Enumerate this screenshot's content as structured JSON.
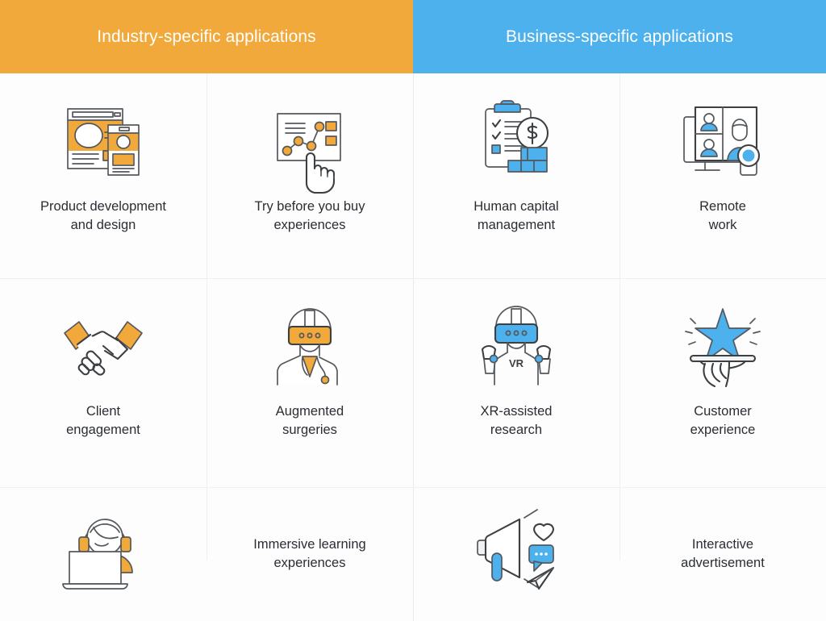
{
  "headers": [
    {
      "label": "Industry-specific applications",
      "color": "#f2a93b"
    },
    {
      "label": "Business-specific applications",
      "color": "#4cb1ec"
    }
  ],
  "palette": {
    "orange": "#f2a93b",
    "blue": "#4cb1ec",
    "line": "#3d4043",
    "text": "#2a2d33",
    "divider": "#eef1f4",
    "background": "#fdfdfd"
  },
  "grid": {
    "columns": 4,
    "rows": 3,
    "cells": [
      {
        "id": "product-development-and-design",
        "icon": "wireframe-screens-icon",
        "label": "Product development\nand design",
        "accent": "#f2a93b",
        "category": "industry"
      },
      {
        "id": "try-before-you-buy-experiences",
        "icon": "interactive-screen-hand-icon",
        "label": "Try before you buy\nexperiences",
        "accent": "#f2a93b",
        "category": "industry"
      },
      {
        "id": "human-capital-management",
        "icon": "clipboard-coin-icon",
        "label": "Human capital\nmanagement",
        "accent": "#4cb1ec",
        "category": "business"
      },
      {
        "id": "remote-work",
        "icon": "video-call-monitor-icon",
        "label": "Remote\nwork",
        "accent": "#4cb1ec",
        "category": "business"
      },
      {
        "id": "client-engagement",
        "icon": "handshake-icon",
        "label": "Client\nengagement",
        "accent": "#f2a93b",
        "category": "industry"
      },
      {
        "id": "augmented-surgeries",
        "icon": "doctor-ar-headset-icon",
        "label": "Augmented\nsurgeries",
        "accent": "#f2a93b",
        "category": "industry"
      },
      {
        "id": "xr-assisted-research",
        "icon": "vr-headset-controllers-icon",
        "label": "XR-assisted\nresearch",
        "accent": "#4cb1ec",
        "category": "business"
      },
      {
        "id": "customer-experience",
        "icon": "hand-tray-star-icon",
        "label": "Customer\nexperience",
        "accent": "#4cb1ec",
        "category": "business"
      },
      {
        "id": "immersive-learning-experiences",
        "icon": "headset-laptop-person-icon",
        "label": "Immersive learning\nexperiences",
        "accent": "#f2a93b",
        "category": "industry"
      },
      {
        "id": "interactive-advertisement",
        "icon": "megaphone-social-icon",
        "label": "Interactive\nadvertisement",
        "accent": "#4cb1ec",
        "category": "business"
      }
    ]
  },
  "icon_labels": {
    "vr_badge": "VR"
  }
}
